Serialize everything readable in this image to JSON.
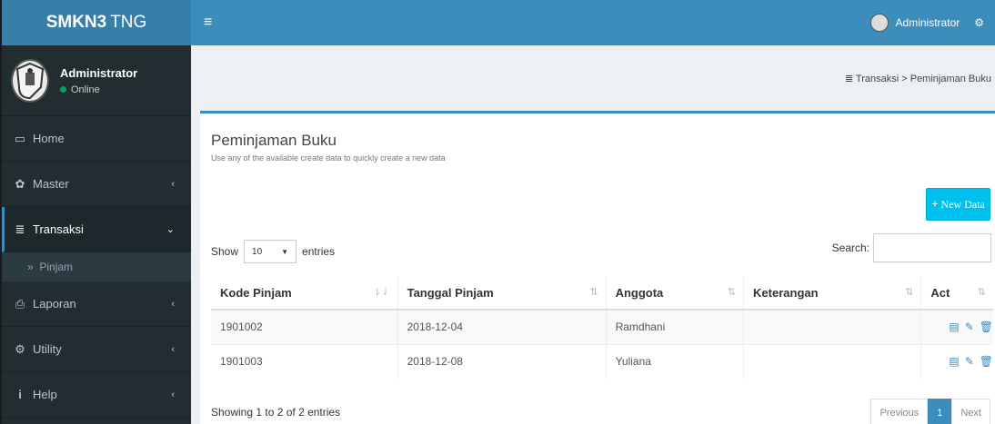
{
  "brand": {
    "bold": "SMKN3",
    "rest": "TNG"
  },
  "sidebar": {
    "user_name": "Administrator",
    "status": "Online",
    "items": [
      {
        "label": "Home",
        "icon": "monitor-icon"
      },
      {
        "label": "Master",
        "icon": "gear-icon"
      },
      {
        "label": "Transaksi",
        "icon": "list-icon"
      },
      {
        "label": "Laporan",
        "icon": "print-icon"
      },
      {
        "label": "Utility",
        "icon": "cogs-icon"
      },
      {
        "label": "Help",
        "icon": "info-icon"
      }
    ],
    "submenu": "Pinjam",
    "submenu_prefix": "»"
  },
  "topbar": {
    "user": "Administrator",
    "menu_glyph": "≡"
  },
  "breadcrumb": "Transaksi > Peminjaman Buku",
  "page": {
    "title": "Peminjaman Buku",
    "subtitle": "Use any of the available create data to quickly create a new data",
    "new_button": "New Data"
  },
  "table": {
    "show_label": "Show",
    "entries_value": "10",
    "entries_label": "entries",
    "search_label": "Search:",
    "headers": [
      "Kode Pinjam",
      "Tanggal Pinjam",
      "Anggota",
      "Keterangan",
      "Act"
    ],
    "rows": [
      {
        "kode": "1901002",
        "tanggal": "2018-12-04",
        "anggota": "Ramdhani",
        "keterangan": ""
      },
      {
        "kode": "1901003",
        "tanggal": "2018-12-08",
        "anggota": "Yuliana",
        "keterangan": ""
      }
    ],
    "info": "Showing 1 to 2 of 2 entries",
    "pager": {
      "prev": "Previous",
      "current": "1",
      "next": "Next"
    }
  }
}
